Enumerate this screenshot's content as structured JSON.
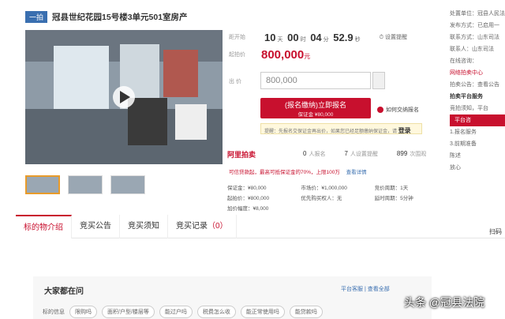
{
  "header": {
    "tag": "一拍",
    "title": "冠县世纪花园15号楼3单元501室房产"
  },
  "countdown": {
    "label": "距开始",
    "days": "10",
    "days_unit": "天",
    "hours": "00",
    "hours_unit": "时",
    "minutes": "04",
    "minutes_unit": "分",
    "seconds": "52.9",
    "seconds_unit": "秒",
    "remind": "设置提醒"
  },
  "start_price": {
    "label": "起拍价",
    "value": "800,000",
    "unit": "元"
  },
  "bid": {
    "label": "出  价",
    "value": "800,000"
  },
  "signup": {
    "label": "(报名缴纳)立即报名",
    "deposit": "保证金 ¥80,000"
  },
  "help_link": "如何交纳报名",
  "notice": {
    "text": "提醒：先报名交保证金再出价，如果您已经足额缴纳保证金，请",
    "action": "登录"
  },
  "platform": "阿里拍卖",
  "stats": [
    {
      "num": "0",
      "label": "人报名"
    },
    {
      "num": "7",
      "label": "人设置提醒"
    },
    {
      "num": "899",
      "label": "次围观"
    }
  ],
  "payment": {
    "text": "可信贷款起，最高可抵保证金的70%，上限100万",
    "link": "查看详情"
  },
  "details": [
    [
      "保证金：¥80,000",
      "市场价：¥1,000,000",
      "竞价周期：1天"
    ],
    [
      "起拍价：¥800,000",
      "优先购买权人：无",
      "延时周期：5分钟"
    ],
    [
      "加价幅度：¥8,000",
      "",
      ""
    ]
  ],
  "right_panel": [
    "处置单位：冠县人民法",
    "发布方式：已启用一",
    "联系方式：山东司法",
    "联系人：山东司法",
    "在线咨询：",
    "网络拍卖中心",
    "拍卖公告：查看公告",
    "拍卖平台服务",
    "竞拍须知，平台",
    "平台咨",
    "1.报名服务",
    "3.前期准备",
    "陈述",
    "放心"
  ],
  "tabs": [
    {
      "label": "标的物介绍",
      "active": true
    },
    {
      "label": "竞买公告"
    },
    {
      "label": "竞买须知"
    },
    {
      "label": "竞买记录",
      "count": "（0）"
    }
  ],
  "scan_label": "扫码",
  "ask": {
    "title": "大家都在问",
    "links": "平台客服 | 查看全部",
    "prefix": "标的信息",
    "chips": [
      "限购吗",
      "面积/户型/楼层等",
      "能过户吗",
      "税费怎么收",
      "能正常使用吗",
      "能贷款吗"
    ]
  },
  "watermark": "头条 @冠县法院"
}
